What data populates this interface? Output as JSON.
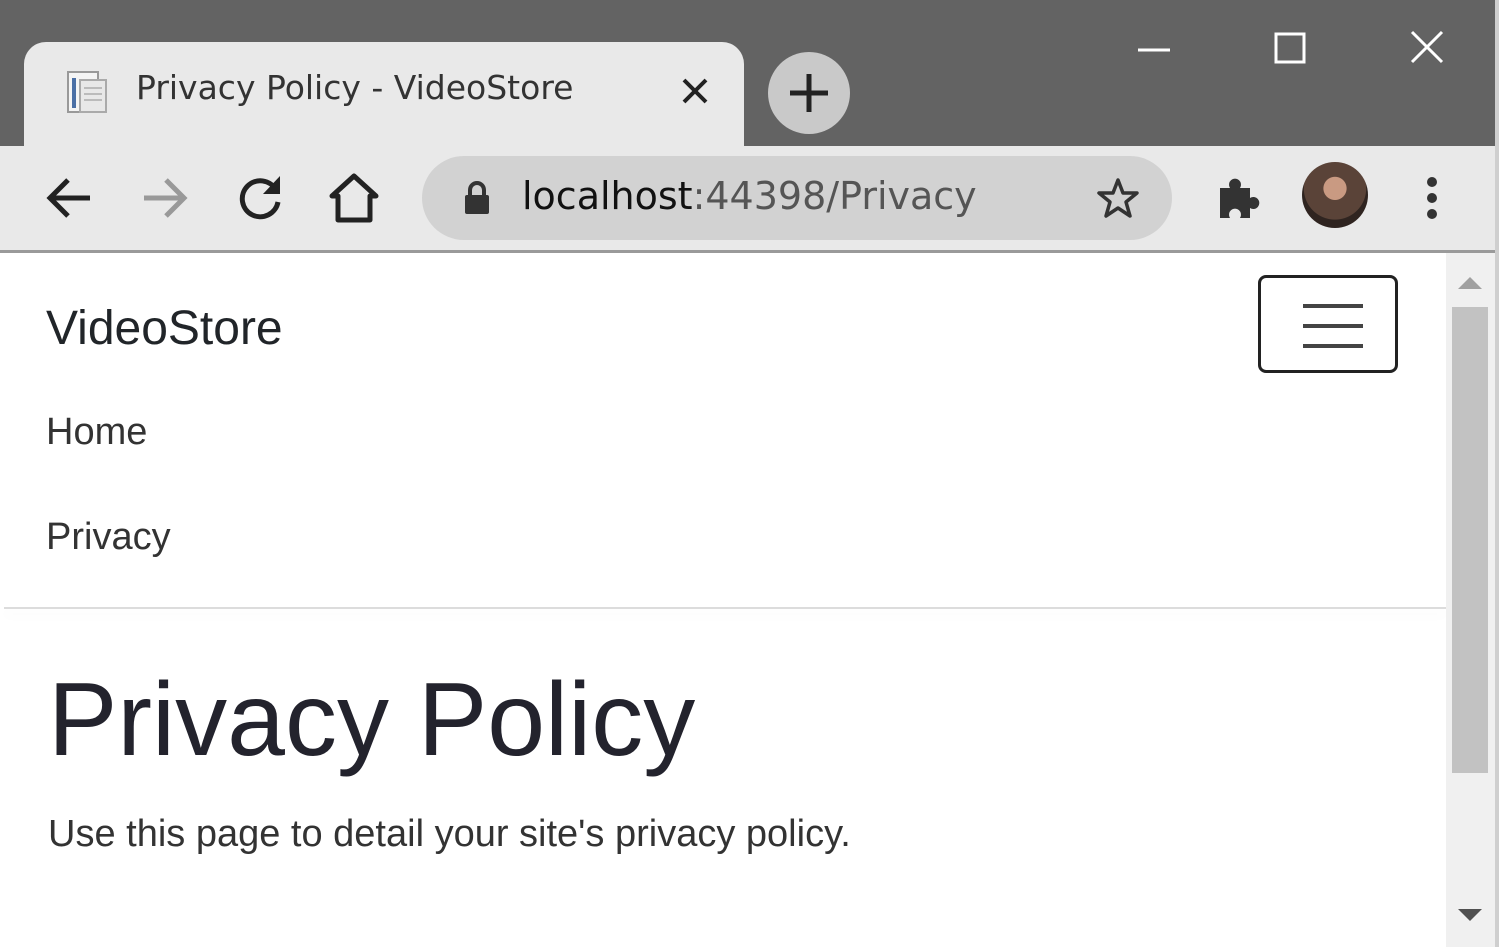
{
  "browser": {
    "tab": {
      "title": "Privacy Policy - VideoStore",
      "favicon": "page-icon",
      "close_icon": "close-icon"
    },
    "new_tab_icon": "plus-icon",
    "window_controls": [
      "minimize-icon",
      "maximize-icon",
      "close-icon"
    ],
    "toolbar": {
      "back_icon": "arrow-left-icon",
      "forward_icon": "arrow-right-icon",
      "reload_icon": "reload-icon",
      "home_icon": "home-icon",
      "lock_icon": "lock-icon",
      "url_host": "localhost",
      "url_rest": ":44398/Privacy",
      "bookmark_icon": "star-icon",
      "extensions_icon": "puzzle-icon",
      "profile": "avatar",
      "menu_icon": "kebab-menu-icon"
    }
  },
  "site": {
    "brand": "VideoStore",
    "nav": [
      "Home",
      "Privacy"
    ],
    "toggler_icon": "hamburger-icon"
  },
  "content": {
    "heading": "Privacy Policy",
    "paragraph": "Use this page to detail your site's privacy policy."
  },
  "colors": {
    "titlebar": "#636363",
    "toolbar": "#e9e9e9",
    "omnibox": "#d2d2d2",
    "text": "#212529"
  }
}
